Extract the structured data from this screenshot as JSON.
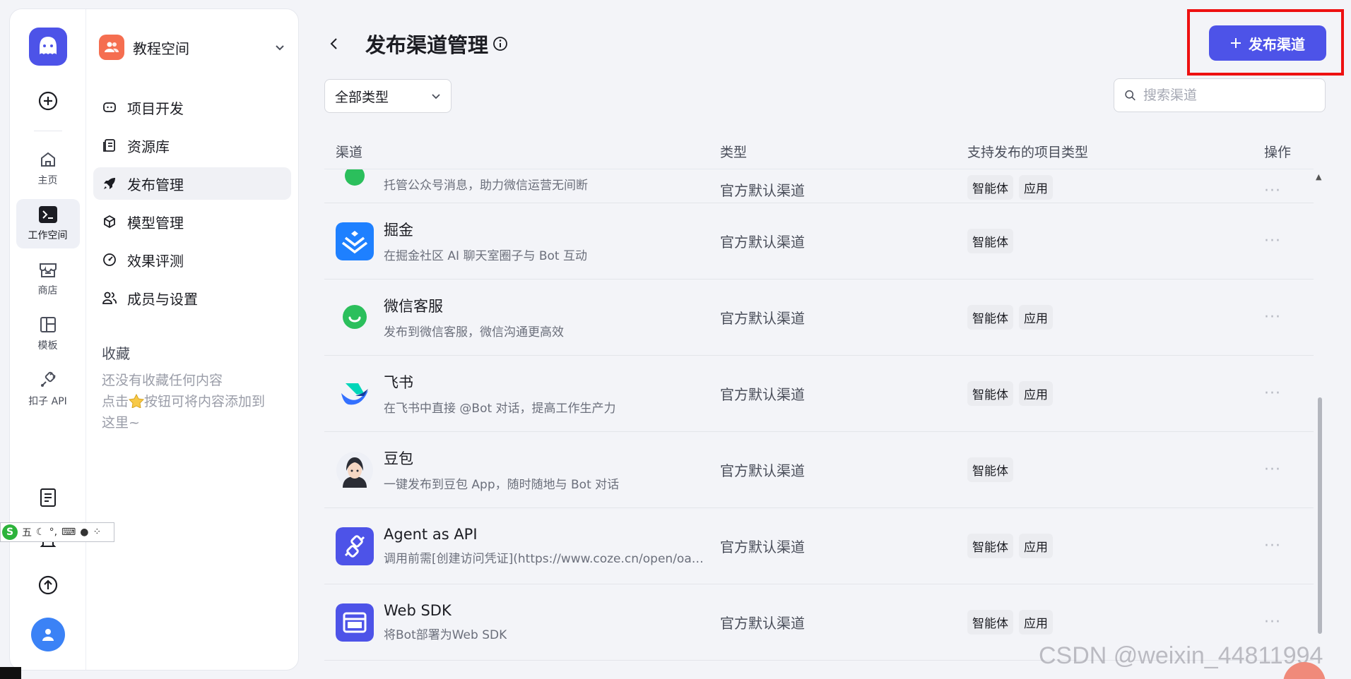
{
  "rail": {
    "items": [
      {
        "label": "主页",
        "icon": "home-icon"
      },
      {
        "label": "工作空间",
        "icon": "terminal-icon"
      },
      {
        "label": "商店",
        "icon": "store-icon"
      },
      {
        "label": "模板",
        "icon": "template-icon"
      },
      {
        "label": "扣子 API",
        "icon": "plug-icon"
      }
    ]
  },
  "workspace": {
    "name": "教程空间",
    "nav": [
      {
        "label": "项目开发",
        "icon": "bot-icon"
      },
      {
        "label": "资源库",
        "icon": "library-icon"
      },
      {
        "label": "发布管理",
        "icon": "rocket-icon"
      },
      {
        "label": "模型管理",
        "icon": "cube-icon"
      },
      {
        "label": "效果评测",
        "icon": "gauge-icon"
      },
      {
        "label": "成员与设置",
        "icon": "users-icon"
      }
    ],
    "favorites_title": "收藏",
    "favorites_empty_line1": "还没有收藏任何内容",
    "favorites_empty_line2_a": "点击",
    "favorites_empty_line2_b": "按钮可将内容添加到",
    "favorites_empty_line3": "这里~"
  },
  "ime": {
    "label": "五"
  },
  "header": {
    "title": "发布渠道管理",
    "publish_button": "发布渠道"
  },
  "filter": {
    "selected": "全部类型"
  },
  "search": {
    "placeholder": "搜索渠道",
    "value": ""
  },
  "table": {
    "headers": {
      "channel": "渠道",
      "type": "类型",
      "project_types": "支持发布的项目类型",
      "actions": "操作"
    },
    "rows": [
      {
        "name": "",
        "desc": "托管公众号消息，助力微信运营无间断",
        "type": "官方默认渠道",
        "tags": [
          "智能体",
          "应用"
        ],
        "icon": "wechat-official-icon",
        "partial": true
      },
      {
        "name": "掘金",
        "desc": "在掘金社区 AI 聊天室圈子与 Bot 互动",
        "type": "官方默认渠道",
        "tags": [
          "智能体"
        ],
        "icon": "juejin-icon"
      },
      {
        "name": "微信客服",
        "desc": "发布到微信客服，微信沟通更高效",
        "type": "官方默认渠道",
        "tags": [
          "智能体",
          "应用"
        ],
        "icon": "wechat-service-icon"
      },
      {
        "name": "飞书",
        "desc": "在飞书中直接 @Bot 对话，提高工作生产力",
        "type": "官方默认渠道",
        "tags": [
          "智能体",
          "应用"
        ],
        "icon": "feishu-icon"
      },
      {
        "name": "豆包",
        "desc": "一键发布到豆包 App，随时随地与 Bot 对话",
        "type": "官方默认渠道",
        "tags": [
          "智能体"
        ],
        "icon": "doubao-icon"
      },
      {
        "name": "Agent as API",
        "desc": "调用前需[创建访问凭证](https://www.coze.cn/open/oauth/pats)",
        "type": "官方默认渠道",
        "tags": [
          "智能体",
          "应用"
        ],
        "icon": "api-plug-icon"
      },
      {
        "name": "Web SDK",
        "desc": "将Bot部署为Web SDK",
        "type": "官方默认渠道",
        "tags": [
          "智能体",
          "应用"
        ],
        "icon": "web-sdk-icon"
      }
    ],
    "more_label": "···"
  },
  "watermark": "CSDN @weixin_44811994",
  "colors": {
    "accent": "#4d53e8",
    "highlight": "#ee1111",
    "workspace_avatar": "#f56e50"
  }
}
